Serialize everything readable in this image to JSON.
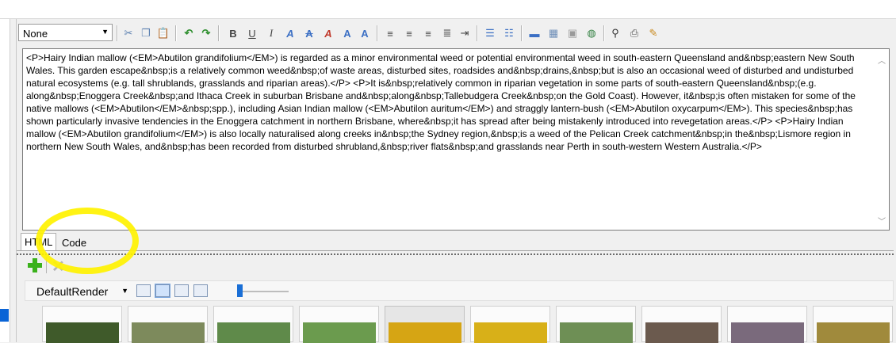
{
  "toolbar": {
    "style_select_value": "None",
    "buttons": [
      "cut-icon",
      "copy-icon",
      "paste-icon",
      "undo-icon",
      "redo-icon",
      "bold-icon",
      "underline-icon",
      "italic-icon",
      "subscript-icon",
      "strikethrough-icon",
      "font-color-icon",
      "grow-font-icon",
      "shrink-font-icon",
      "align-left-icon",
      "align-center-icon",
      "align-right-icon",
      "justify-icon",
      "indent-icon",
      "bullet-list-icon",
      "numbered-list-icon",
      "horizontal-rule-icon",
      "table-icon",
      "image-icon",
      "hyperlink-icon",
      "find-icon",
      "print-icon",
      "clean-icon"
    ]
  },
  "editor": {
    "text": "<P>Hairy Indian mallow (<EM>Abutilon grandifolium</EM>) is regarded as a minor environmental weed or potential environmental weed in south-eastern Queensland and&nbsp;eastern New South Wales. This garden escape&nbsp;is a relatively common weed&nbsp;of waste areas, disturbed sites, roadsides and&nbsp;drains,&nbsp;but is also an occasional weed of disturbed and undisturbed natural ecosystems (e.g. tall shrublands, grasslands and riparian areas).</P>\n<P>It is&nbsp;relatively common in riparian vegetation in some parts of south-eastern Queensland&nbsp;(e.g. along&nbsp;Enoggera Creek&nbsp;and Ithaca Creek in suburban Brisbane and&nbsp;along&nbsp;Tallebudgera Creek&nbsp;on the Gold Coast). However, it&nbsp;is often mistaken for some of the native mallows (<EM>Abutilon</EM>&nbsp;spp.), including Asian Indian mallow (<EM>Abutilon auritum</EM>) and straggly lantern-bush (<EM>Abutilon oxycarpum</EM>). This species&nbsp;has shown particularly invasive tendencies in the Enoggera catchment in northern Brisbane, where&nbsp;it has spread after being mistakenly introduced into revegetation areas.</P>\n<P>Hairy Indian mallow (<EM>Abutilon grandifolium</EM>) is also locally naturalised along creeks in&nbsp;the Sydney region,&nbsp;is a weed of the Pelican Creek catchment&nbsp;in the&nbsp;Lismore region in northern New South Wales, and&nbsp;has been recorded from disturbed shrubland,&nbsp;river flats&nbsp;and grasslands near Perth in south-western Western Australia.</P>"
  },
  "tabs": {
    "html": "HTML",
    "code": "Code"
  },
  "viewbar": {
    "renderer": "DefaultRender"
  },
  "colors": {
    "highlight": "#fff200",
    "accent": "#1a6fd6",
    "add_green": "#3bb11c"
  },
  "thumbnails": [
    {
      "name": "thumb-1",
      "selected": false,
      "color": "#3f5a2a"
    },
    {
      "name": "thumb-2",
      "selected": false,
      "color": "#7d8a5c"
    },
    {
      "name": "thumb-3",
      "selected": false,
      "color": "#5f8a4a"
    },
    {
      "name": "thumb-4",
      "selected": false,
      "color": "#6b9b4e"
    },
    {
      "name": "thumb-5",
      "selected": true,
      "color": "#d6a514"
    },
    {
      "name": "thumb-6",
      "selected": false,
      "color": "#d8b018"
    },
    {
      "name": "thumb-7",
      "selected": false,
      "color": "#6e8f55"
    },
    {
      "name": "thumb-8",
      "selected": false,
      "color": "#6b5a4e"
    },
    {
      "name": "thumb-9",
      "selected": false,
      "color": "#7a6a7c"
    },
    {
      "name": "thumb-10",
      "selected": false,
      "color": "#a08a3c"
    }
  ]
}
